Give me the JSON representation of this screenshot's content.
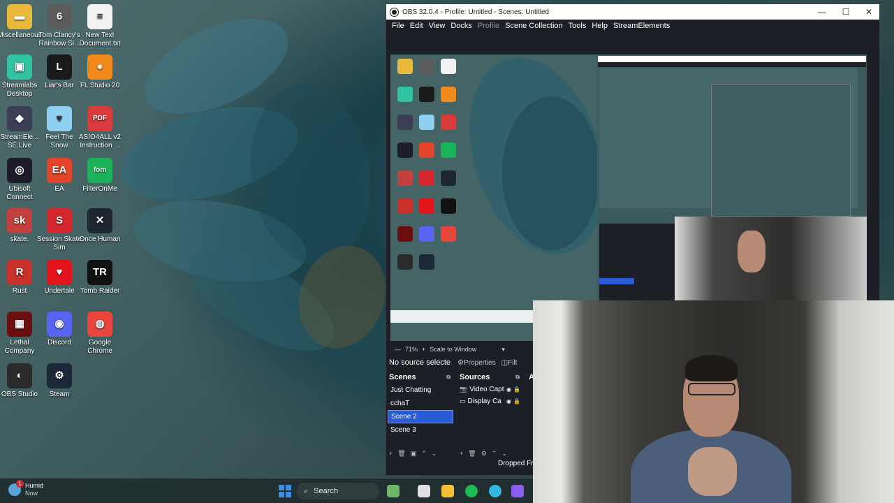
{
  "desktop": {
    "icons": [
      {
        "label": "Miscellaneous",
        "icon": "folder-icon",
        "color": "#e8b93a",
        "glyph": "▬"
      },
      {
        "label": "Tom Clancy's Rainbow Si...",
        "icon": "rainbow-six-icon",
        "color": "#5b5b5b",
        "glyph": "6"
      },
      {
        "label": "New Text Document.txt",
        "icon": "text-file-icon",
        "color": "#f2f2f2",
        "glyph": "≡"
      },
      {
        "label": "Streamlabs Desktop",
        "icon": "streamlabs-icon",
        "color": "#31c3a2",
        "glyph": "▣"
      },
      {
        "label": "Liar's Bar",
        "icon": "liars-bar-icon",
        "color": "#1a1a1a",
        "glyph": "L"
      },
      {
        "label": "FL Studio 20",
        "icon": "fl-studio-icon",
        "color": "#f08a1c",
        "glyph": "●"
      },
      {
        "label": "StreamEle... SE.Live",
        "icon": "streamelements-icon",
        "color": "#3a3f55",
        "glyph": "◆"
      },
      {
        "label": "Feel The Snow",
        "icon": "feel-the-snow-icon",
        "color": "#8fd0f0",
        "glyph": "♥"
      },
      {
        "label": "ASIO4ALL v2 Instruction ...",
        "icon": "pdf-icon",
        "color": "#d93a3a",
        "glyph": "PDF"
      },
      {
        "label": "Ubisoft Connect",
        "icon": "ubisoft-icon",
        "color": "#1c1c2a",
        "glyph": "◎"
      },
      {
        "label": "EA",
        "icon": "ea-icon",
        "color": "#e2452a",
        "glyph": "EA"
      },
      {
        "label": "FilterOnMe",
        "icon": "filteronme-icon",
        "color": "#1bb35a",
        "glyph": "fom"
      },
      {
        "label": "skate.",
        "icon": "skate-icon",
        "color": "#c2413c",
        "glyph": "sk"
      },
      {
        "label": "Session Skate Sim",
        "icon": "session-icon",
        "color": "#d3272d",
        "glyph": "S"
      },
      {
        "label": "Once Human",
        "icon": "once-human-icon",
        "color": "#1c2730",
        "glyph": "✕"
      },
      {
        "label": "Rust",
        "icon": "rust-icon",
        "color": "#c8322a",
        "glyph": "R"
      },
      {
        "label": "Undertale",
        "icon": "undertale-icon",
        "color": "#e3141b",
        "glyph": "♥"
      },
      {
        "label": "Tomb Raider",
        "icon": "tomb-raider-icon",
        "color": "#111111",
        "glyph": "TR"
      },
      {
        "label": "Lethal Company",
        "icon": "lethal-company-icon",
        "color": "#6a0e0e",
        "glyph": "▦"
      },
      {
        "label": "Discord",
        "icon": "discord-icon",
        "color": "#5865f2",
        "glyph": "◉"
      },
      {
        "label": "Google Chrome",
        "icon": "chrome-icon",
        "color": "#e8453c",
        "glyph": "◍"
      },
      {
        "label": "OBS Studio",
        "icon": "obs-icon",
        "color": "#2b2b2b",
        "glyph": "◐"
      },
      {
        "label": "Steam",
        "icon": "steam-icon",
        "color": "#1b2838",
        "glyph": "⚙"
      }
    ]
  },
  "obs": {
    "title": "OBS 32.0.4 - Profile: Untitled - Scenes: Untitled",
    "window_controls": {
      "minimize": "—",
      "maximize": "☐",
      "close": "✕"
    },
    "menu": [
      "File",
      "Edit",
      "View",
      "Docks",
      "Profile",
      "Scene Collection",
      "Tools",
      "Help",
      "StreamElements"
    ],
    "preview_bar": {
      "zoom": "71%",
      "mode": "Scale to Window"
    },
    "source_toolbar": {
      "no_source": "No source selecte",
      "properties": "Properties",
      "filters": "Filt"
    },
    "scenes": {
      "header": "Scenes",
      "items": [
        "Just Chatting",
        "cchaT",
        "Scene 2",
        "Scene 3"
      ],
      "selected": "Scene 2"
    },
    "sources": {
      "header": "Sources",
      "items": [
        {
          "label": "Video Capt",
          "icon": "camera-icon",
          "glyph": "📷"
        },
        {
          "label": "Display Ca",
          "icon": "monitor-icon",
          "glyph": "▭"
        }
      ]
    },
    "audio_header": "Au",
    "status": {
      "dropped": "Dropped Fr"
    },
    "footer_buttons": [
      "+",
      "🗑",
      "▣",
      "⌃",
      "⌄"
    ]
  },
  "taskbar": {
    "notification": {
      "app": "Humid",
      "time": "Now",
      "count": "1"
    },
    "search_placeholder": "Search",
    "apps": [
      {
        "icon": "widgets-icon",
        "color": "#6fb56a"
      },
      {
        "icon": "task-view-icon",
        "color": "#e0e0e0"
      },
      {
        "icon": "file-explorer-icon",
        "color": "#f2c037"
      },
      {
        "icon": "spotify-icon",
        "color": "#1db954"
      },
      {
        "icon": "edge-icon",
        "color": "#2fb8e0"
      },
      {
        "icon": "copilot-icon",
        "color": "#8a5cf0"
      }
    ]
  }
}
